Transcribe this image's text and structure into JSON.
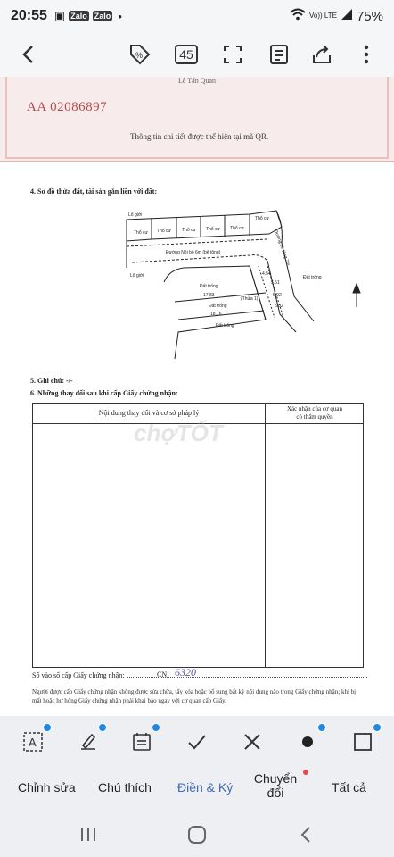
{
  "status": {
    "time": "20:55",
    "notifications": [
      "Zalo",
      "Zalo"
    ],
    "network": "Vo)) LTE",
    "battery": "75%"
  },
  "toolbar": {
    "page_count": "45"
  },
  "document": {
    "signature": "Lê Tấn Quan",
    "serial": "AA 02086897",
    "qr_note": "Thông tin chi tiết được thể hiện tại mã QR.",
    "section4_title": "4. Sơ đồ thửa đất, tài sản gắn liền với đất:",
    "diagram_labels": {
      "lo_gioi_1": "Lô giới",
      "lo_gioi_2": "Lô giới",
      "tho_cu": [
        "Thổ cư",
        "Thổ cư",
        "Thổ cư",
        "Thổ cư",
        "Thổ cư",
        "Thổ cư"
      ],
      "street": "Đường Nội bộ 6m (bê tông)",
      "street_right": "Đường bê tông 7m",
      "dat_trong": [
        "Đất trống",
        "Đất trống",
        "Đất trống",
        "Đất trống"
      ],
      "dims": [
        "17.83",
        "18.16",
        "5.51",
        "4.54",
        "5.02",
        "5.02"
      ],
      "thua": "(Thửa 1)"
    },
    "section5_title": "5. Ghi chú: -/-",
    "section6_title": "6. Những thay đổi sau khi cấp Giấy chứng nhận:",
    "table_header_left": "Nội dung thay đổi và cơ sở pháp lý",
    "table_header_right_1": "Xác nhận của cơ quan",
    "table_header_right_2": "có thẩm quyền",
    "watermark": "chợTỐT",
    "registry_label": "Số vào sổ cấp Giấy chứng nhận:",
    "registry_prefix": "CN",
    "registry_number": "6320",
    "note_text": "Người được cấp Giấy chứng nhận không được sửa chữa, tẩy xóa hoặc bổ sung bất kỳ nội dung nào trong Giấy chứng nhận; khi bị mất hoặc hư hỏng Giấy chứng nhận phải khai báo ngay với cơ quan cấp Giấy."
  },
  "tabs": [
    {
      "label": "Chỉnh sửa"
    },
    {
      "label": "Chú thích"
    },
    {
      "label": "Điền & Ký"
    },
    {
      "label": "Chuyển đổi"
    },
    {
      "label": "Tất cả"
    }
  ],
  "colors": {
    "accent": "#3e6bb3",
    "badge": "#1e88e5",
    "serial": "#b54a4a"
  }
}
